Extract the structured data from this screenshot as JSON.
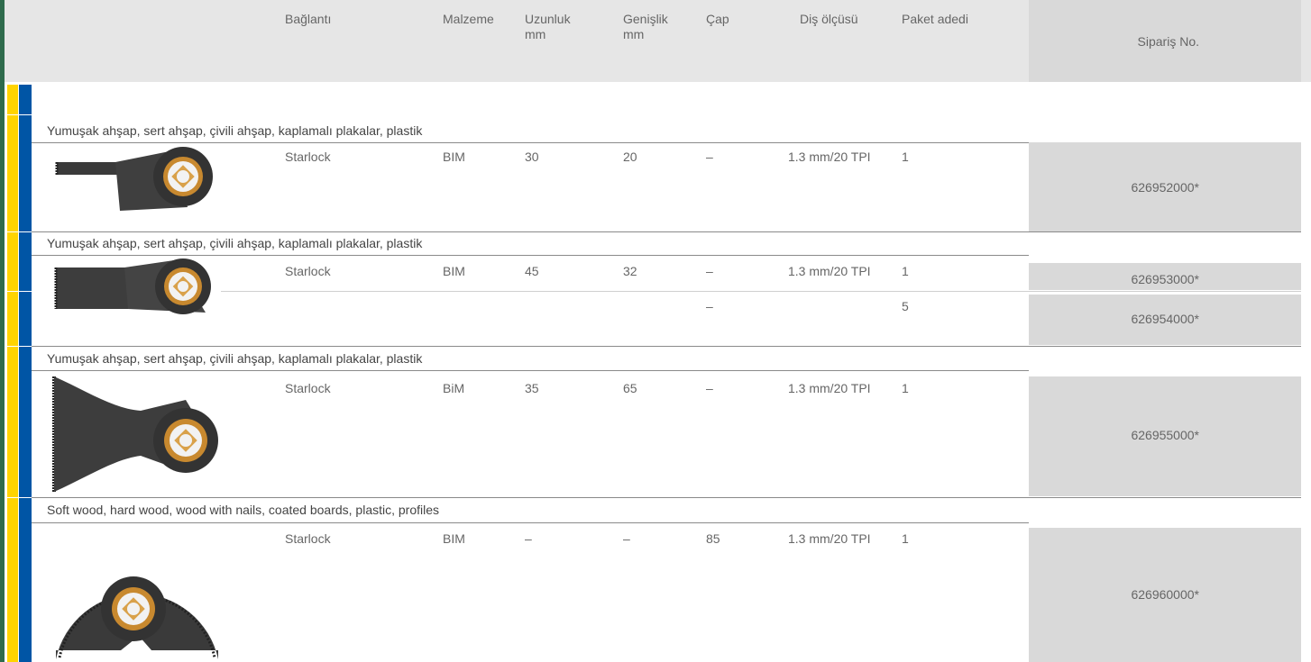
{
  "header": {
    "connection": "Bağlantı",
    "material": "Malzeme",
    "length_title": "Uzunluk",
    "length_unit": "mm",
    "width_title": "Genişlik",
    "width_unit": "mm",
    "diameter": "Çap",
    "tooth_pitch": "Diş ölçüsü",
    "pack_qty": "Paket adedi",
    "order_no": "Sipariş  No."
  },
  "groups": [
    {
      "description": "Yumuşak ahşap, sert ahşap, çivili ahşap, kaplamalı plakalar, plastik",
      "rows": [
        {
          "connection": "Starlock",
          "material": "BIM",
          "length": "30",
          "width": "20",
          "diameter": "–",
          "tooth": "1.3 mm/20 TPI",
          "pack": "1",
          "order": "626952000*"
        }
      ]
    },
    {
      "description": "Yumuşak ahşap, sert ahşap, çivili ahşap, kaplamalı plakalar, plastik",
      "rows": [
        {
          "connection": "Starlock",
          "material": "BIM",
          "length": "45",
          "width": "32",
          "diameter": "–",
          "tooth": "1.3 mm/20 TPI",
          "pack": "1",
          "order": "626953000*"
        },
        {
          "connection": "",
          "material": "",
          "length": "",
          "width": "",
          "diameter": "–",
          "tooth": "",
          "pack": "5",
          "order": "626954000*"
        }
      ]
    },
    {
      "description": "Yumuşak ahşap, sert ahşap, çivili ahşap, kaplamalı plakalar, plastik",
      "rows": [
        {
          "connection": "Starlock",
          "material": "BiM",
          "length": "35",
          "width": "65",
          "diameter": "–",
          "tooth": "1.3 mm/20 TPI",
          "pack": "1",
          "order": "626955000*"
        }
      ]
    },
    {
      "description": "Soft wood, hard wood, wood with nails, coated boards, plastic, profiles",
      "rows": [
        {
          "connection": "Starlock",
          "material": "BIM",
          "length": "–",
          "width": "–",
          "diameter": "85",
          "tooth": "1.3 mm/20 TPI",
          "pack": "1",
          "order": "626960000*"
        }
      ]
    }
  ],
  "colors": {
    "accent_yellow": "#ffd400",
    "accent_blue": "#0055a5",
    "order_bg": "#d9d9d9",
    "header_bg": "#e6e6e6"
  },
  "icons": [
    "narrow-plunge-blade-icon",
    "medium-plunge-blade-icon",
    "wide-plunge-blade-icon",
    "segment-saw-blade-icon"
  ]
}
